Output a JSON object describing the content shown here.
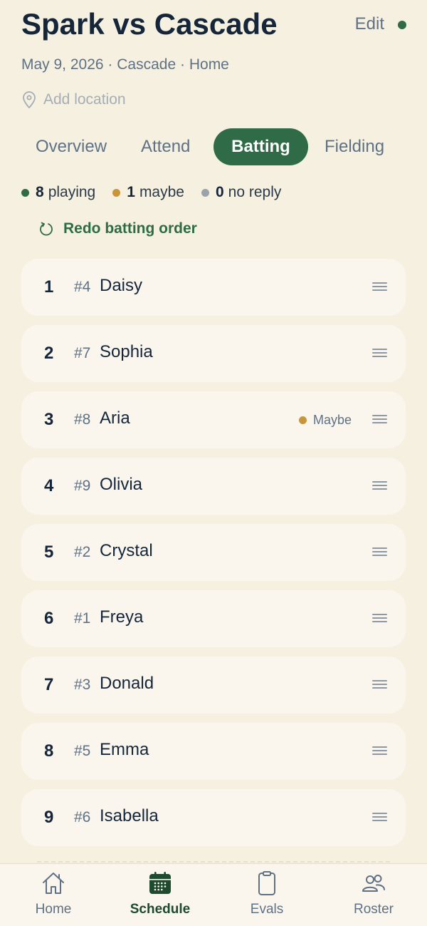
{
  "header": {
    "title": "Spark vs Cascade",
    "edit_label": "Edit",
    "accent": "#2e6b46"
  },
  "game_info": {
    "date": "May 9, 2026",
    "opponent": "Cascade",
    "venue": "Home",
    "separator": "·",
    "location_placeholder": "Add location",
    "location_icon": "map-pin-icon"
  },
  "tabs": [
    {
      "label": "Overview",
      "active": false
    },
    {
      "label": "Attend",
      "active": false
    },
    {
      "label": "Batting",
      "active": true
    },
    {
      "label": "Fielding",
      "active": false
    }
  ],
  "attendance": [
    {
      "count": "8",
      "label": "playing",
      "color": "#2e6b46"
    },
    {
      "count": "1",
      "label": "maybe",
      "color": "#c9953a"
    },
    {
      "count": "0",
      "label": "no reply",
      "color": "#9aa3ad"
    }
  ],
  "redo": {
    "label": "Redo batting order",
    "icon": "refresh-icon"
  },
  "batting_order": [
    {
      "order": "1",
      "jersey": "#4",
      "name": "Daisy",
      "status": ""
    },
    {
      "order": "2",
      "jersey": "#7",
      "name": "Sophia",
      "status": ""
    },
    {
      "order": "3",
      "jersey": "#8",
      "name": "Aria",
      "status": "Maybe"
    },
    {
      "order": "4",
      "jersey": "#9",
      "name": "Olivia",
      "status": ""
    },
    {
      "order": "5",
      "jersey": "#2",
      "name": "Crystal",
      "status": ""
    },
    {
      "order": "6",
      "jersey": "#1",
      "name": "Freya",
      "status": ""
    },
    {
      "order": "7",
      "jersey": "#3",
      "name": "Donald",
      "status": ""
    },
    {
      "order": "8",
      "jersey": "#5",
      "name": "Emma",
      "status": ""
    },
    {
      "order": "9",
      "jersey": "#6",
      "name": "Isabella",
      "status": ""
    }
  ],
  "nav": [
    {
      "label": "Home",
      "icon": "home-icon",
      "active": false
    },
    {
      "label": "Schedule",
      "icon": "calendar-icon",
      "active": true
    },
    {
      "label": "Evals",
      "icon": "clipboard-icon",
      "active": false
    },
    {
      "label": "Roster",
      "icon": "users-icon",
      "active": false
    }
  ]
}
